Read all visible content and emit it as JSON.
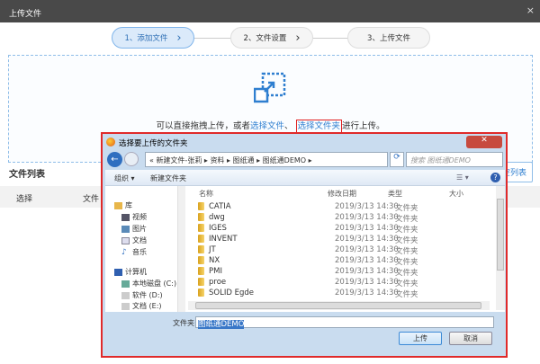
{
  "window": {
    "title": "上传文件",
    "close": "×"
  },
  "steps": [
    {
      "label": "1、添加文件",
      "arrow": "›"
    },
    {
      "label": "2、文件设置",
      "arrow": "›"
    },
    {
      "label": "3、上传文件"
    }
  ],
  "dropzone": {
    "text_before": "可以直接拖拽上传，或者",
    "link_files": "选择文件",
    "sep": "、",
    "link_folder": "选择文件夹",
    "text_after": "进行上传。"
  },
  "file_list": {
    "title": "文件列表",
    "clear_button": "空列表",
    "columns": [
      "选择",
      "文件"
    ]
  },
  "dialog": {
    "title": "选择要上传的文件夹",
    "close": "✕",
    "breadcrumb": [
      "新建文件-张莉",
      "资料",
      "图纸通",
      "图纸通DEMO"
    ],
    "search_placeholder": "搜索 图纸通DEMO",
    "toolbar": {
      "organize": "组织 ▾",
      "new_folder": "新建文件夹"
    },
    "nav": {
      "libraries": "库",
      "videos": "视频",
      "pictures": "图片",
      "documents": "文档",
      "music": "音乐",
      "computer": "计算机",
      "drive_c": "本地磁盘 (C:)",
      "drive_d": "软件 (D:)",
      "drive_e": "文档 (E:)"
    },
    "columns": {
      "name": "名称",
      "modified": "修改日期",
      "type": "类型",
      "size": "大小"
    },
    "rows": [
      {
        "name": "CATIA",
        "modified": "2019/3/13 14:30",
        "type": "文件夹"
      },
      {
        "name": "dwg",
        "modified": "2019/3/13 14:30",
        "type": "文件夹"
      },
      {
        "name": "IGES",
        "modified": "2019/3/13 14:30",
        "type": "文件夹"
      },
      {
        "name": "INVENT",
        "modified": "2019/3/13 14:30",
        "type": "文件夹"
      },
      {
        "name": "JT",
        "modified": "2019/3/13 14:30",
        "type": "文件夹"
      },
      {
        "name": "NX",
        "modified": "2019/3/13 14:30",
        "type": "文件夹"
      },
      {
        "name": "PMI",
        "modified": "2019/3/13 14:30",
        "type": "文件夹"
      },
      {
        "name": "proe",
        "modified": "2019/3/13 14:30",
        "type": "文件夹"
      },
      {
        "name": "SOLID Egde",
        "modified": "2019/3/13 14:30",
        "type": "文件夹"
      }
    ],
    "folder_label": "文件夹:",
    "folder_value": "图纸通DEMO",
    "upload_button": "上传",
    "cancel_button": "取消"
  }
}
